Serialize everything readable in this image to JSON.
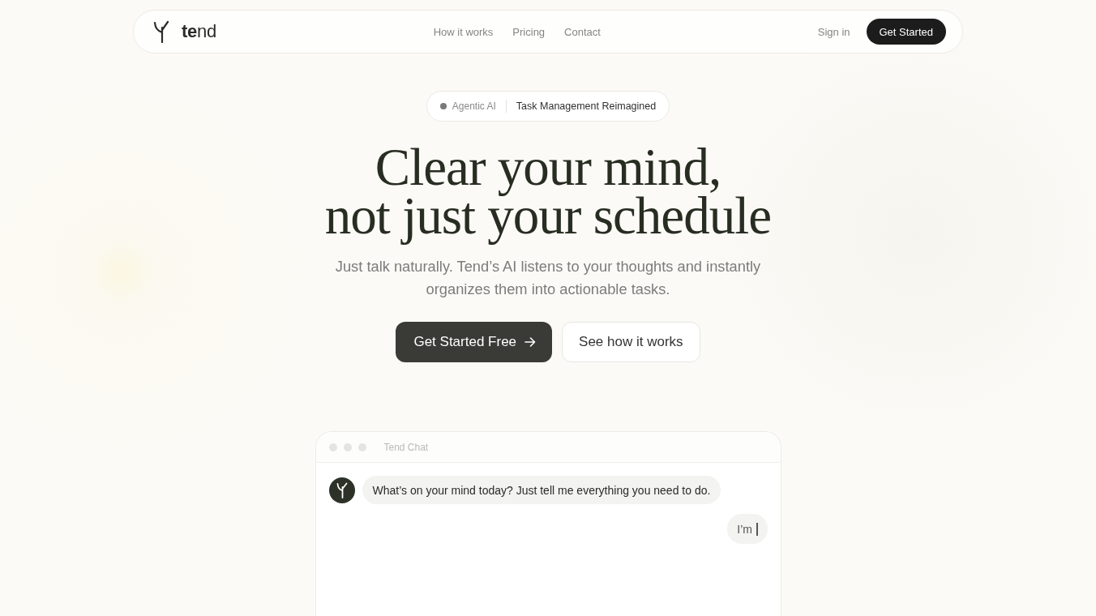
{
  "nav": {
    "logo": "**te**nd",
    "links": [
      {
        "label": "How it works"
      },
      {
        "label": "Pricing"
      },
      {
        "label": "Contact"
      }
    ],
    "sign_in": "Sign in",
    "cta": "Get Started"
  },
  "hero": {
    "badge": {
      "tag": "Agentic AI",
      "text": "Task Management Reimagined"
    },
    "headline": [
      "Clear your mind,",
      "not just your schedule"
    ],
    "subtitle": "Just talk naturally. Tend’s AI listens to your thoughts and instantly organizes them into actionable tasks.",
    "buttons": [
      {
        "label": "Get Started Free",
        "kind": "primary"
      },
      {
        "label": "See how it works",
        "kind": "secondary"
      }
    ]
  },
  "chat": {
    "title": "Tend Chat",
    "messages": [
      {
        "kind": "incoming",
        "text": "What’s on your mind today? Just tell me everything you need to do.",
        "typing": false
      },
      {
        "kind": "outgoing",
        "text": "I’m",
        "typing": true
      }
    ]
  }
}
